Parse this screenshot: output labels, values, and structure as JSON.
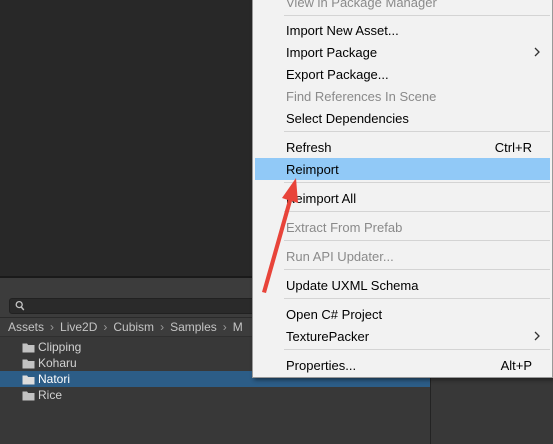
{
  "colors": {
    "scene_bg": "#282828",
    "panel_bg": "#383838",
    "selection": "#2c5d87",
    "menu_bg": "#f2f2f2",
    "menu_highlight": "#91c9f7",
    "annotation_arrow": "#e8443a"
  },
  "project": {
    "search": {
      "placeholder": "",
      "icon": "search-icon"
    },
    "breadcrumb": [
      "Assets",
      "Live2D",
      "Cubism",
      "Samples",
      "M"
    ],
    "folders": [
      {
        "label": "Clipping",
        "selected": false
      },
      {
        "label": "Koharu",
        "selected": false
      },
      {
        "label": "Natori",
        "selected": true
      },
      {
        "label": "Rice",
        "selected": false
      }
    ]
  },
  "menu": {
    "items": [
      {
        "label": "View in Package Manager",
        "disabled": true
      },
      {
        "label": "Import New Asset..."
      },
      {
        "label": "Import Package",
        "submenu": true
      },
      {
        "label": "Export Package..."
      },
      {
        "label": "Find References In Scene",
        "disabled": true
      },
      {
        "label": "Select Dependencies"
      },
      {
        "label": "Refresh",
        "shortcut": "Ctrl+R"
      },
      {
        "label": "Reimport",
        "highlighted": true
      },
      {
        "label": "Reimport All"
      },
      {
        "label": "Extract From Prefab",
        "disabled": true
      },
      {
        "label": "Run API Updater...",
        "disabled": true
      },
      {
        "label": "Update UXML Schema"
      },
      {
        "label": "Open C# Project"
      },
      {
        "label": "TexturePacker",
        "submenu": true
      },
      {
        "label": "Properties...",
        "shortcut": "Alt+P"
      }
    ]
  }
}
